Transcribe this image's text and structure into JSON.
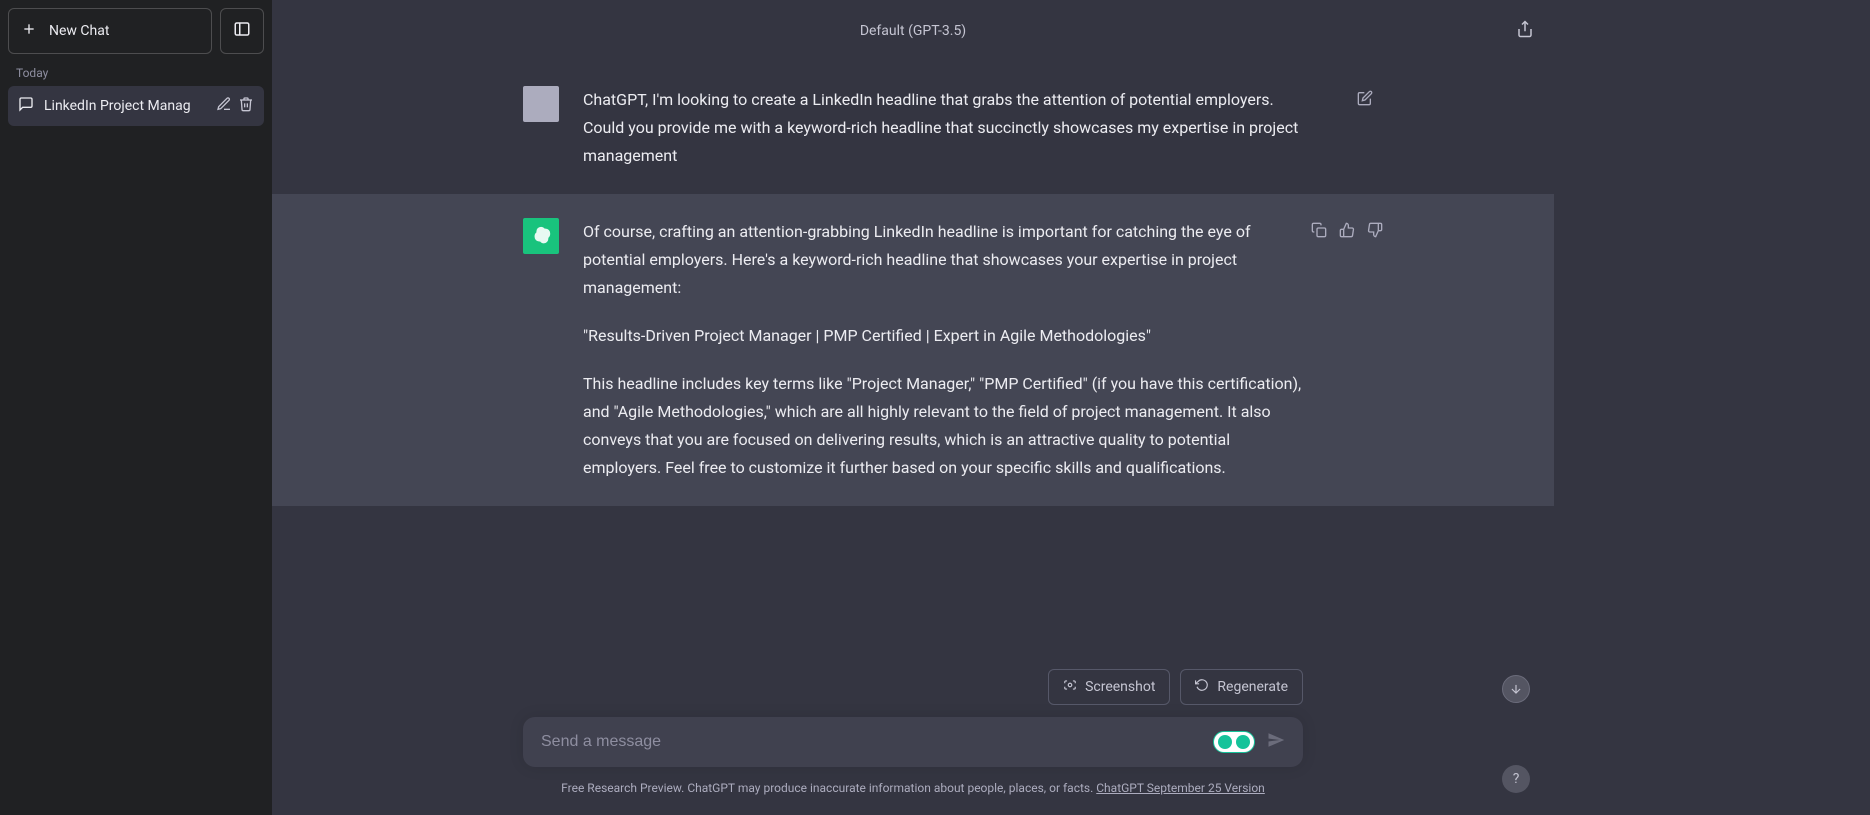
{
  "sidebar": {
    "new_chat_label": "New Chat",
    "section_label": "Today",
    "items": [
      {
        "title": "LinkedIn Project Manag"
      }
    ]
  },
  "header": {
    "model_label": "Default (GPT-3.5)"
  },
  "conversation": {
    "user_message": "ChatGPT, I'm looking to create a LinkedIn headline that grabs the attention of potential employers. Could you provide me with a keyword-rich headline that succinctly showcases my expertise in project management",
    "assistant_p1": "Of course, crafting an attention-grabbing LinkedIn headline is important for catching the eye of potential employers. Here's a keyword-rich headline that showcases your expertise in project management:",
    "assistant_p2": "\"Results-Driven Project Manager | PMP Certified | Expert in Agile Methodologies\"",
    "assistant_p3": "This headline includes key terms like \"Project Manager,\" \"PMP Certified\" (if you have this certification), and \"Agile Methodologies,\" which are all highly relevant to the field of project management. It also conveys that you are focused on delivering results, which is an attractive quality to potential employers. Feel free to customize it further based on your specific skills and qualifications."
  },
  "actions": {
    "screenshot_label": "Screenshot",
    "regenerate_label": "Regenerate"
  },
  "input": {
    "placeholder": "Send a message"
  },
  "footer": {
    "disclaimer_prefix": "Free Research Preview. ChatGPT may produce inaccurate information about people, places, or facts. ",
    "disclaimer_link": "ChatGPT September 25 Version"
  },
  "help_label": "?"
}
